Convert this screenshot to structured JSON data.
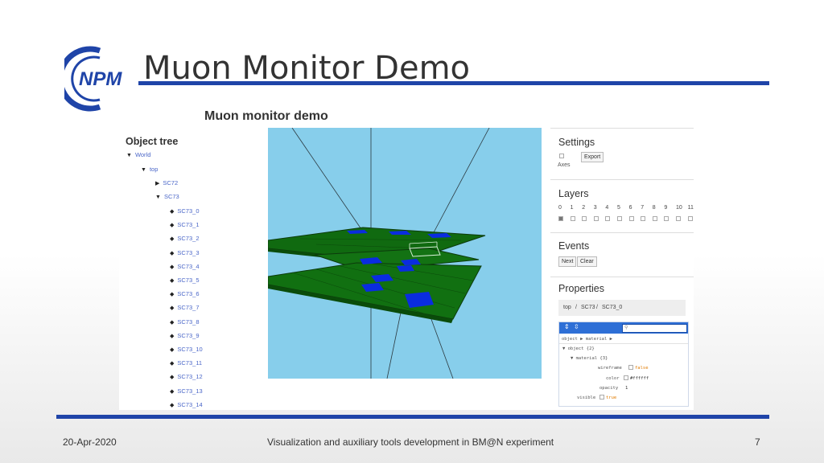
{
  "slide": {
    "title": "Muon Monitor Demo",
    "footer_date": "20-Apr-2020",
    "footer_center": "Visualization and auxiliary tools development in BM@N experiment",
    "page_number": "7",
    "logo_text": "NPM",
    "accent_color": "#1f44a8"
  },
  "app": {
    "title": "Muon monitor demo",
    "tree": {
      "heading": "Object tree",
      "world": "World",
      "top": "top",
      "sc72": "SC72",
      "sc73": "SC73",
      "children": [
        "SC73_0",
        "SC73_1",
        "SC73_2",
        "SC73_3",
        "SC73_4",
        "SC73_5",
        "SC73_6",
        "SC73_7",
        "SC73_8",
        "SC73_9",
        "SC73_10",
        "SC73_11",
        "SC73_12",
        "SC73_13",
        "SC73_14"
      ]
    },
    "settings": {
      "heading": "Settings",
      "export_label": "Export",
      "axes_label": "Axes"
    },
    "layers": {
      "heading": "Layers",
      "numbers": [
        "0",
        "1",
        "2",
        "3",
        "4",
        "5",
        "6",
        "7",
        "8",
        "9",
        "10",
        "11"
      ]
    },
    "events": {
      "heading": "Events",
      "next_label": "Next",
      "clear_label": "Clear"
    },
    "properties": {
      "heading": "Properties",
      "path": [
        "top",
        "/",
        "SC73",
        "/",
        "SC73_0"
      ],
      "editor": {
        "crumb": "object ▶ material ▶",
        "object_key": "▼ object {2}",
        "material_key": "▼ material {3}",
        "wireframe_key": "wireframe",
        "wireframe_val": "false",
        "color_key": "color",
        "color_val": "#ffffff",
        "opacity_key": "opacity",
        "opacity_val": "1",
        "visible_key": "visible",
        "visible_val": "true"
      }
    },
    "colors": {
      "viewport_bg": "#87ceeb",
      "plane": "#116b11",
      "hit": "#0a2ce0"
    }
  }
}
